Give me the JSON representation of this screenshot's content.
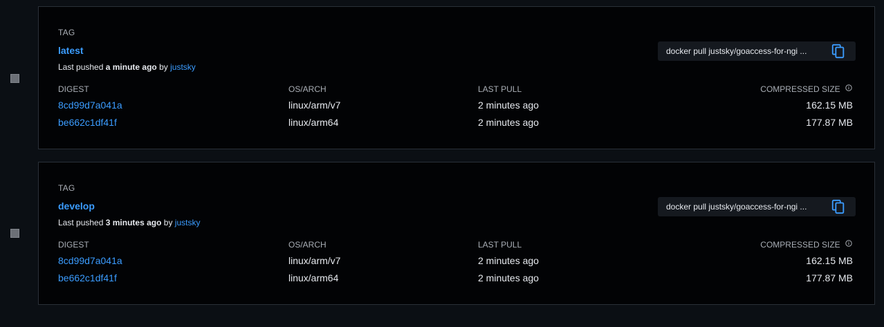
{
  "columns": {
    "digest": "DIGEST",
    "os_arch": "OS/ARCH",
    "last_pull": "LAST PULL",
    "compressed_size": "COMPRESSED SIZE"
  },
  "tags": [
    {
      "label": "TAG",
      "name": "latest",
      "pushed_prefix": "Last pushed",
      "pushed_time": "a minute ago",
      "pushed_by": "by",
      "user": "justsky",
      "pull_command": "docker pull justsky/goaccess-for-ngi ...",
      "rows": [
        {
          "digest": "8cd99d7a041a",
          "os_arch": "linux/arm/v7",
          "last_pull": "2 minutes ago",
          "size": "162.15 MB"
        },
        {
          "digest": "be662c1df41f",
          "os_arch": "linux/arm64",
          "last_pull": "2 minutes ago",
          "size": "177.87 MB"
        }
      ]
    },
    {
      "label": "TAG",
      "name": "develop",
      "pushed_prefix": "Last pushed",
      "pushed_time": "3 minutes ago",
      "pushed_by": "by",
      "user": "justsky",
      "pull_command": "docker pull justsky/goaccess-for-ngi ...",
      "rows": [
        {
          "digest": "8cd99d7a041a",
          "os_arch": "linux/arm/v7",
          "last_pull": "2 minutes ago",
          "size": "162.15 MB"
        },
        {
          "digest": "be662c1df41f",
          "os_arch": "linux/arm64",
          "last_pull": "2 minutes ago",
          "size": "177.87 MB"
        }
      ]
    }
  ],
  "icons": {
    "copy": "copy-icon",
    "info": "info-icon",
    "checkbox": "checkbox"
  },
  "colors": {
    "accent": "#3b9cff",
    "background": "#0b0f14",
    "card": "#020305"
  }
}
